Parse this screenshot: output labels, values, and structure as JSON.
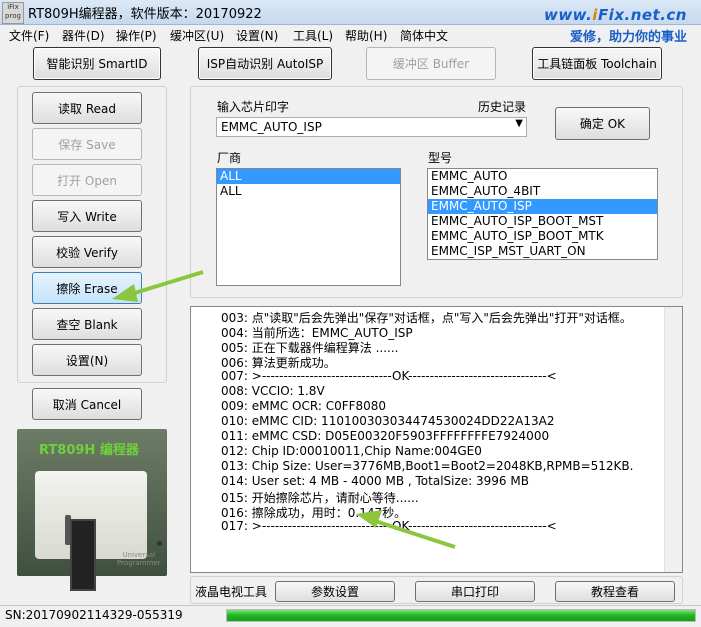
{
  "window": {
    "title": "RT809H编程器，软件版本：20170922",
    "logo_text": "iFix prog",
    "brand_url_prefix": "www.",
    "brand_url_i": "i",
    "brand_url_rest": "Fix.net.cn",
    "brand_slogan": "爱修，助力你的事业"
  },
  "menu": [
    "文件(F)",
    "器件(D)",
    "操作(P)",
    "缓冲区(U)",
    "设置(N)",
    "工具(L)",
    "帮助(H)",
    "简体中文"
  ],
  "toolbar": {
    "smart_id": "智能识别 SmartID",
    "isp_auto": "ISP自动识别 AutoISP",
    "buffer": "缓冲区 Buffer",
    "toolchain": "工具链面板 Toolchain"
  },
  "side_buttons": {
    "read": "读取 Read",
    "save": "保存 Save",
    "open": "打开 Open",
    "write": "写入 Write",
    "verify": "校验 Verify",
    "erase": "擦除 Erase",
    "blank": "查空 Blank",
    "settings": "设置(N)",
    "cancel": "取消 Cancel"
  },
  "device_panel": {
    "title": "RT809H 编程器",
    "device_brand": "Universal Programmer"
  },
  "chip_select": {
    "input_label": "输入芯片印字",
    "history_label": "历史记录",
    "chip_value": "EMMC_AUTO_ISP",
    "confirm": "确定 OK",
    "vendor_label": "厂商",
    "model_label": "型号",
    "vendors": [
      {
        "text": "ALL",
        "selected": true
      },
      {
        "text": "ALL",
        "selected": false
      }
    ],
    "models": [
      {
        "text": "EMMC_AUTO",
        "selected": false
      },
      {
        "text": "EMMC_AUTO_4BIT",
        "selected": false
      },
      {
        "text": "EMMC_AUTO_ISP",
        "selected": true
      },
      {
        "text": "EMMC_AUTO_ISP_BOOT_MST",
        "selected": false
      },
      {
        "text": "EMMC_AUTO_ISP_BOOT_MTK",
        "selected": false
      },
      {
        "text": "EMMC_ISP_MST_UART_ON",
        "selected": false
      }
    ]
  },
  "log": [
    "003: 点\"读取\"后会先弹出\"保存\"对话框，点\"写入\"后会先弹出\"打开\"对话框。",
    "004: 当前所选：EMMC_AUTO_ISP",
    "005: 正在下载器件编程算法 ......",
    "006: 算法更新成功。",
    "007: >------------------------------OK--------------------------------<",
    "008: VCCIO: 1.8V",
    "009: eMMC OCR: C0FF8080",
    "010: eMMC CID:  110100303034474530024DD22A13A2",
    "011: eMMC CSD: D05E00320F5903FFFFFFFFE7924000",
    "012: Chip ID:00010011,Chip Name:004GE0",
    "013: Chip Size: User=3776MB,Boot1=Boot2=2048KB,RPMB=512KB.",
    "014: User set: 4 MB - 4000 MB , TotalSize: 3996 MB",
    "015: 开始擦除芯片，请耐心等待......",
    "016: 擦除成功，用时：0.147秒。",
    "017: >------------------------------OK--------------------------------<"
  ],
  "bottom_tools": {
    "label": "液晶电视工具",
    "params": "参数设置",
    "serial": "串口打印",
    "tutorial": "教程查看"
  },
  "status": {
    "sn": "SN:20170902114329-055319",
    "progress": 1.0
  },
  "colors": {
    "accent": "#3399ff",
    "progress": "#1fb41f",
    "arrow": "#8cc63f",
    "brand": "#1a5fc8"
  }
}
